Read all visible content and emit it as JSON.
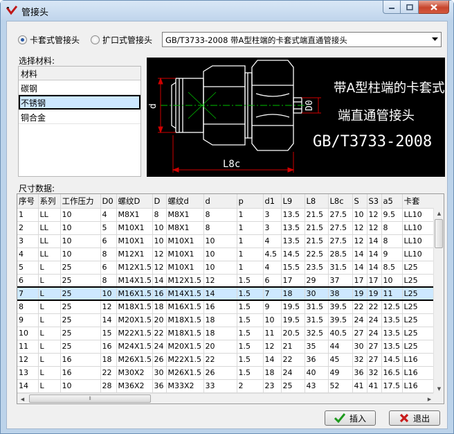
{
  "window": {
    "title": "管接头"
  },
  "options": {
    "radio_1": "卡套式管接头",
    "radio_2": "扩口式管接头",
    "selected": "radio_1"
  },
  "standard_combo": {
    "value": "GB/T3733-2008 带A型柱端的卡套式端直通管接头"
  },
  "material": {
    "label": "选择材料:",
    "header": "材料",
    "items": [
      "碳钢",
      "不锈钢",
      "铜合金"
    ],
    "selected": "不锈钢"
  },
  "drawing": {
    "caption_line1": "带A型柱端的卡套式",
    "caption_line2": "端直通管接头",
    "standard_code": "GB/T3733-2008",
    "dim_d": "d",
    "dim_d0": "D0",
    "dim_l8c": "L8c"
  },
  "size_data": {
    "label": "尺寸数据:",
    "columns": [
      "序号",
      "系列",
      "工作压力",
      "D0",
      "螺纹D",
      "D",
      "螺纹d",
      "d",
      "p",
      "d1",
      "L9",
      "L8",
      "L8c",
      "S",
      "S3",
      "a5",
      "卡套"
    ],
    "rows": [
      [
        "1",
        "LL",
        "10",
        "4",
        "M8X1",
        "8",
        "M8X1",
        "8",
        "1",
        "3",
        "13.5",
        "21.5",
        "27.5",
        "10",
        "12",
        "9.5",
        "LL10"
      ],
      [
        "2",
        "LL",
        "10",
        "5",
        "M10X1",
        "10",
        "M8X1",
        "8",
        "1",
        "3",
        "13.5",
        "21.5",
        "27.5",
        "12",
        "12",
        "8",
        "LL10"
      ],
      [
        "3",
        "LL",
        "10",
        "6",
        "M10X1",
        "10",
        "M10X1",
        "10",
        "1",
        "4",
        "13.5",
        "21.5",
        "27.5",
        "12",
        "14",
        "8",
        "LL10"
      ],
      [
        "4",
        "LL",
        "10",
        "8",
        "M12X1",
        "12",
        "M10X1",
        "10",
        "1",
        "4.5",
        "14.5",
        "22.5",
        "28.5",
        "14",
        "14",
        "9",
        "LL10"
      ],
      [
        "5",
        "L",
        "25",
        "6",
        "M12X1.5",
        "12",
        "M10X1",
        "10",
        "1",
        "4",
        "15.5",
        "23.5",
        "31.5",
        "14",
        "14",
        "8.5",
        "L25"
      ],
      [
        "6",
        "L",
        "25",
        "8",
        "M14X1.5",
        "14",
        "M12X1.5",
        "12",
        "1.5",
        "6",
        "17",
        "29",
        "37",
        "17",
        "17",
        "10",
        "L25"
      ],
      [
        "7",
        "L",
        "25",
        "10",
        "M16X1.5",
        "16",
        "M14X1.5",
        "14",
        "1.5",
        "7",
        "18",
        "30",
        "38",
        "19",
        "19",
        "11",
        "L25"
      ],
      [
        "8",
        "L",
        "25",
        "12",
        "M18X1.5",
        "18",
        "M16X1.5",
        "16",
        "1.5",
        "9",
        "19.5",
        "31.5",
        "39.5",
        "22",
        "22",
        "12.5",
        "L25"
      ],
      [
        "9",
        "L",
        "25",
        "14",
        "M20X1.5",
        "20",
        "M18X1.5",
        "18",
        "1.5",
        "10",
        "19.5",
        "31.5",
        "39.5",
        "24",
        "24",
        "13.5",
        "L25"
      ],
      [
        "10",
        "L",
        "25",
        "15",
        "M22X1.5",
        "22",
        "M18X1.5",
        "18",
        "1.5",
        "11",
        "20.5",
        "32.5",
        "40.5",
        "27",
        "24",
        "13.5",
        "L25"
      ],
      [
        "11",
        "L",
        "25",
        "16",
        "M24X1.5",
        "24",
        "M20X1.5",
        "20",
        "1.5",
        "12",
        "21",
        "35",
        "44",
        "30",
        "27",
        "13.5",
        "L25"
      ],
      [
        "12",
        "L",
        "16",
        "18",
        "M26X1.5",
        "26",
        "M22X1.5",
        "22",
        "1.5",
        "14",
        "22",
        "36",
        "45",
        "32",
        "27",
        "14.5",
        "L16"
      ],
      [
        "13",
        "L",
        "16",
        "22",
        "M30X2",
        "30",
        "M26X1.5",
        "26",
        "1.5",
        "18",
        "24",
        "40",
        "49",
        "36",
        "32",
        "16.5",
        "L16"
      ],
      [
        "14",
        "L",
        "10",
        "28",
        "M36X2",
        "36",
        "M33X2",
        "33",
        "2",
        "23",
        "25",
        "43",
        "52",
        "41",
        "41",
        "17.5",
        "L16"
      ]
    ],
    "selected_row": "7"
  },
  "buttons": {
    "insert": "插入",
    "exit": "退出"
  },
  "colors": {
    "selection": "#cde8ff",
    "drawing_bg": "#000000",
    "drawing_line": "#ffffff",
    "drawing_center": "#00c000",
    "dim_line": "#d00000"
  }
}
